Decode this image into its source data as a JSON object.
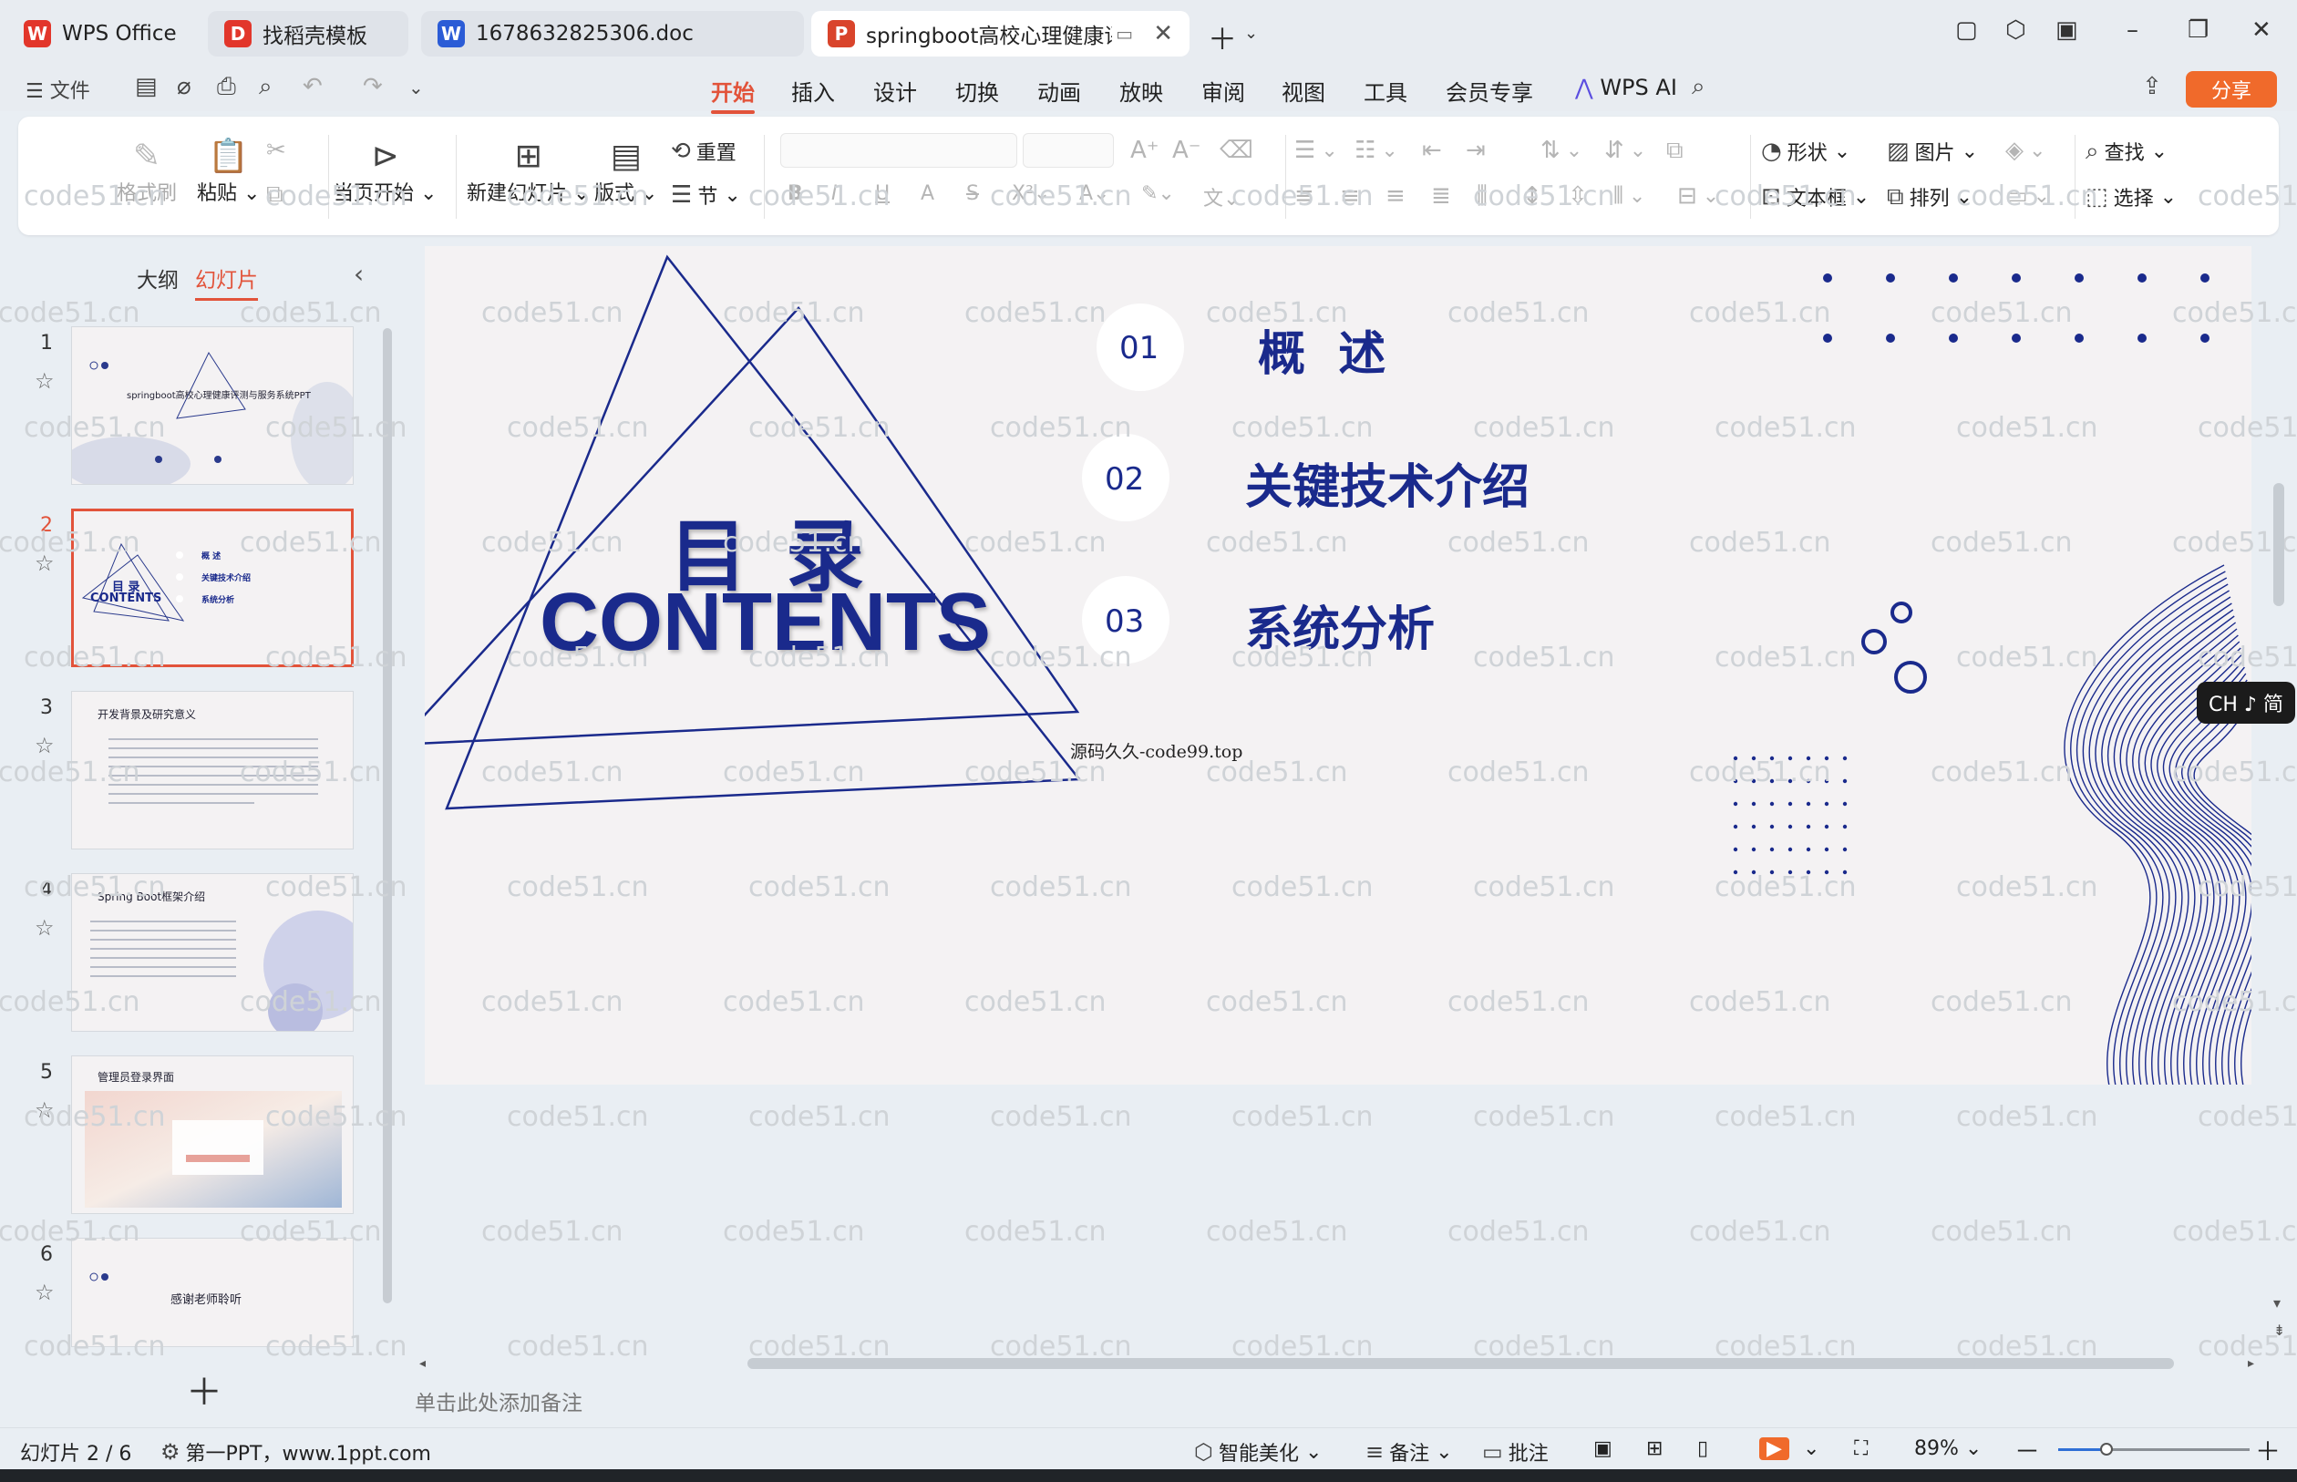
{
  "tabs": [
    {
      "label": "WPS Office",
      "icon": "wps-logo-icon",
      "color": "#e2362b",
      "glyph": "W"
    },
    {
      "label": "找稻壳模板",
      "icon": "docer-icon",
      "color": "#e2362b",
      "glyph": "D"
    },
    {
      "label": "1678632825306.doc",
      "icon": "word-doc-icon",
      "color": "#2b5cd6",
      "glyph": "W"
    },
    {
      "label": "springboot高校心理健康评测",
      "icon": "ppt-icon",
      "color": "#d9442b",
      "glyph": "P"
    }
  ],
  "menu": {
    "file": "文件",
    "tabs": [
      "开始",
      "插入",
      "设计",
      "切换",
      "动画",
      "放映",
      "审阅",
      "视图",
      "工具",
      "会员专享",
      "WPS AI"
    ],
    "active_tab": "开始",
    "share": "分享"
  },
  "ribbon": {
    "format_painter": "格式刷",
    "paste": "粘贴",
    "play_current": "当页开始",
    "new_slide": "新建幻灯片",
    "layout": "版式",
    "reset": "重置",
    "section": "节",
    "shape": "形状",
    "picture": "图片",
    "find": "查找",
    "textbox": "文本框",
    "arrange": "排列",
    "select": "选择"
  },
  "left_panel": {
    "tab_outline": "大纲",
    "tab_slides": "幻灯片",
    "active_tab": "幻灯片",
    "slides": [
      {
        "num": "1",
        "title": "springboot高校心理健康评测与服务系统PPT",
        "active": false
      },
      {
        "num": "2",
        "title": "目 录 CONTENTS",
        "active": true
      },
      {
        "num": "3",
        "title": "开发背景及研究意义",
        "active": false
      },
      {
        "num": "4",
        "title": "Spring Boot框架介绍",
        "active": false
      },
      {
        "num": "5",
        "title": "管理员登录界面",
        "active": false
      },
      {
        "num": "6",
        "title": "感谢老师聆听",
        "active": false
      }
    ],
    "thumb2_items": [
      "概  述",
      "关键技术介绍",
      "系统分析"
    ]
  },
  "slide": {
    "title_cn": "目 录",
    "title_en": "CONTENTS",
    "items": [
      {
        "num": "01",
        "text": "概  述"
      },
      {
        "num": "02",
        "text": "关键技术介绍"
      },
      {
        "num": "03",
        "text": "系统分析"
      }
    ],
    "source_note": "源码久久-code99.top",
    "accent_color": "#1a2a8c"
  },
  "notes_placeholder": "单击此处添加备注",
  "watermark": "code51.cn",
  "ime": "CH ♪ 简",
  "status": {
    "slide_counter": "幻灯片 2 / 6",
    "theme": "第一PPT，www.1ppt.com",
    "beautify": "智能美化",
    "notes": "备注",
    "comments": "批注",
    "zoom": "89%",
    "zoom_fraction": 0.25
  }
}
